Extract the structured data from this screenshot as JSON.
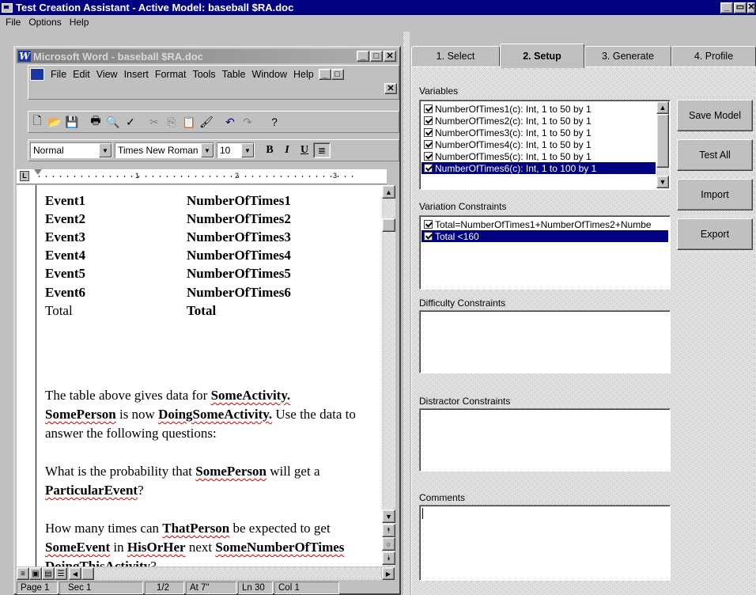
{
  "app": {
    "title": "Test Creation Assistant - Active Model: baseball $RA.doc",
    "menu": [
      "File",
      "Options",
      "Help"
    ],
    "caption_buttons": [
      "minimize-icon",
      "maximize-icon",
      "close-icon"
    ]
  },
  "word": {
    "title": "Microsoft Word - baseball $RA.doc",
    "menu": [
      "File",
      "Edit",
      "View",
      "Insert",
      "Format",
      "Tools",
      "Table",
      "Window",
      "Help"
    ],
    "style": "Normal",
    "font": "Times New Roman",
    "size": "10",
    "format_buttons": [
      "B",
      "I",
      "U"
    ],
    "ruler_marks": [
      "1",
      "2",
      "3"
    ],
    "table": [
      {
        "event": "Event1",
        "var": "NumberOfTimes1"
      },
      {
        "event": "Event2",
        "var": "NumberOfTimes2"
      },
      {
        "event": "Event3",
        "var": "NumberOfTimes3"
      },
      {
        "event": "Event4",
        "var": "NumberOfTimes4"
      },
      {
        "event": "Event5",
        "var": "NumberOfTimes5"
      },
      {
        "event": "Event6",
        "var": "NumberOfTimes6"
      },
      {
        "event": "Total",
        "var": "Total"
      }
    ],
    "para1": {
      "t1": "The table above gives data for ",
      "v1": "SomeActivity.",
      "v2": "SomePerson",
      "t2": " is now ",
      "v3": "DoingSomeActivity.",
      "t3": "  Use the data to answer the following questions:"
    },
    "para2": {
      "t1": "What is the probability that ",
      "v1": "SomePerson",
      "t2": " will get a ",
      "v2": "ParticularEvent",
      "t3": "?"
    },
    "para3": {
      "t1": "How many times can ",
      "v1": "ThatPerson",
      "t2": " be expected to get ",
      "v2": "SomeEvent",
      "t3": " in ",
      "v3": "HisOrHer",
      "t4": " next ",
      "v4": "SomeNumberOfTimes",
      "t5": " ",
      "v5": "DoingThisActivity",
      "t6": "?"
    },
    "status": {
      "page": "Page 1",
      "sec": "Sec 1",
      "pages": "1/2",
      "at": "At 7\"",
      "ln": "Ln 30",
      "col": "Col 1"
    }
  },
  "tabs": [
    {
      "label": "1. Select",
      "active": false
    },
    {
      "label": "2. Setup",
      "active": true
    },
    {
      "label": "3. Generate",
      "active": false
    },
    {
      "label": "4. Profile",
      "active": false
    }
  ],
  "setup": {
    "variables_label": "Variables",
    "variables": [
      {
        "text": "NumberOfTimes1(c): Int, 1 to 50 by 1",
        "checked": true,
        "selected": false
      },
      {
        "text": "NumberOfTimes2(c): Int, 1 to 50 by 1",
        "checked": true,
        "selected": false
      },
      {
        "text": "NumberOfTimes3(c): Int, 1 to 50 by 1",
        "checked": true,
        "selected": false
      },
      {
        "text": "NumberOfTimes4(c): Int, 1 to 50 by 1",
        "checked": true,
        "selected": false
      },
      {
        "text": "NumberOfTimes5(c): Int, 1 to 50 by 1",
        "checked": true,
        "selected": false
      },
      {
        "text": "NumberOfTimes6(c): Int, 1 to 100 by 1",
        "checked": true,
        "selected": true
      }
    ],
    "variation_label": "Variation Constraints",
    "variation": [
      {
        "text": "Total=NumberOfTimes1+NumberOfTimes2+Numbe",
        "checked": true,
        "selected": false
      },
      {
        "text": "Total <160",
        "checked": true,
        "selected": true
      }
    ],
    "difficulty_label": "Difficulty Constraints",
    "distractor_label": "Distractor Constraints",
    "comments_label": "Comments",
    "comments_value": "",
    "buttons": {
      "save": "Save Model",
      "test": "Test All",
      "import": "Import",
      "export": "Export"
    }
  }
}
